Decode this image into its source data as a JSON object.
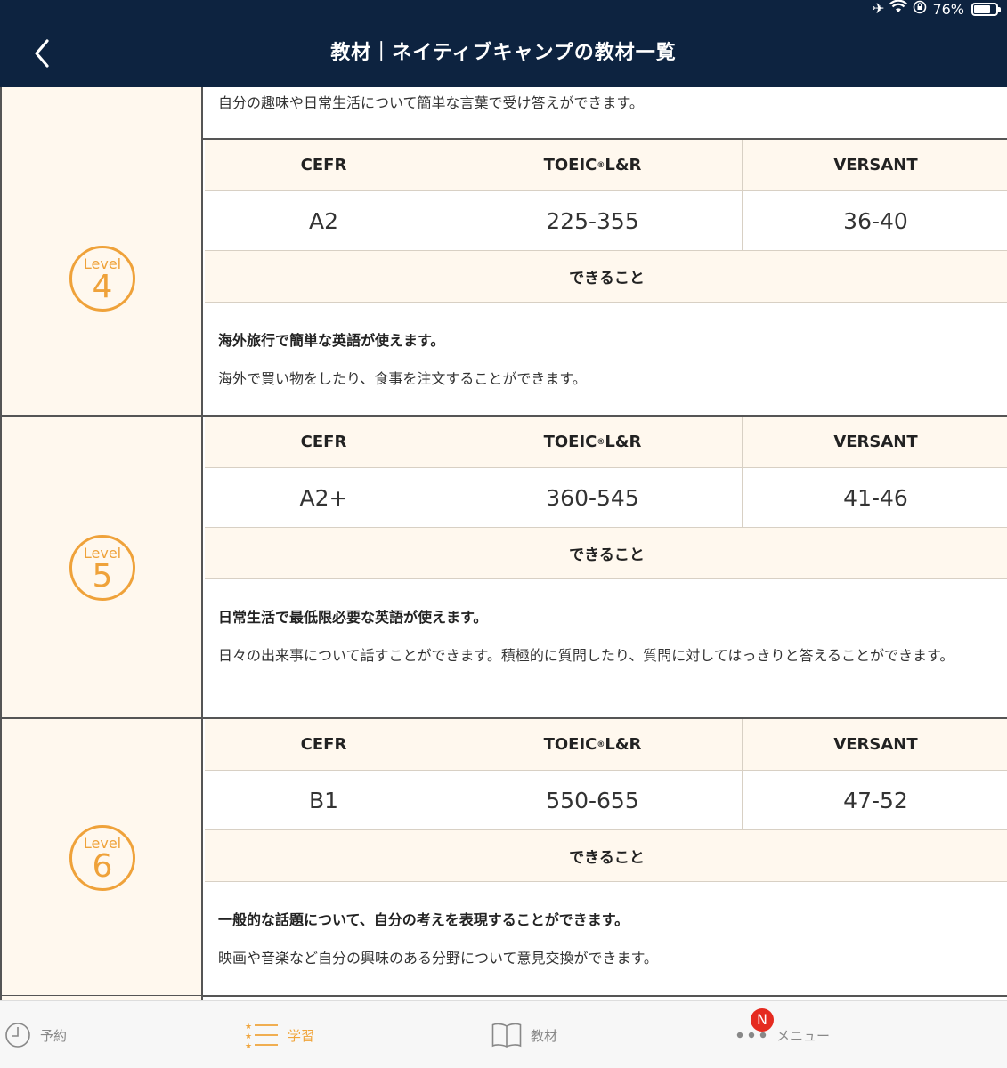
{
  "status_bar": {
    "battery_text": "76%",
    "battery_level": 0.76,
    "icons": [
      "airplane-icon",
      "wifi-icon",
      "orientation-lock-icon",
      "battery-icon"
    ]
  },
  "header": {
    "back_icon": "chevron-left-icon",
    "title": "教材｜ネイティブキャンプの教材一覧"
  },
  "top_partial_text": "自分の趣味や日常生活について簡単な言葉で受け答えができます。",
  "table": {
    "col_cefr": "CEFR",
    "col_toeic_prefix": "TOEIC",
    "col_toeic_mark": "®",
    "col_toeic_suffix": "L&R",
    "col_versant": "VERSANT",
    "can_do_label": "できること"
  },
  "levels": [
    {
      "badge_word": "Level",
      "number": "4",
      "cefr": "A2",
      "toeic": "225-355",
      "versant": "36-40",
      "headline": "海外旅行で簡単な英語が使えます。",
      "body": "海外で買い物をしたり、食事を注文することができます。"
    },
    {
      "badge_word": "Level",
      "number": "5",
      "cefr": "A2+",
      "toeic": "360-545",
      "versant": "41-46",
      "headline": "日常生活で最低限必要な英語が使えます。",
      "body": "日々の出来事について話すことができます。積極的に質問したり、質問に対してはっきりと答えることができます。"
    },
    {
      "badge_word": "Level",
      "number": "6",
      "cefr": "B1",
      "toeic": "550-655",
      "versant": "47-52",
      "headline": "一般的な話題について、自分の考えを表現することができます。",
      "body": "映画や音楽など自分の興味のある分野について意見交換ができます。"
    }
  ],
  "tabbar": {
    "tabs": [
      {
        "label": "予約",
        "icon": "clock-icon",
        "active": false
      },
      {
        "label": "学習",
        "icon": "star-list-icon",
        "active": true
      },
      {
        "label": "教材",
        "icon": "book-icon",
        "active": false
      },
      {
        "label": "メニュー",
        "icon": "more-dots-icon",
        "active": false
      }
    ],
    "notification_badge": "N"
  },
  "colors": {
    "header_bg": "#0d2340",
    "accent": "#f0a43a",
    "cell_bg": "#fff8ee",
    "badge_red": "#e52b20"
  }
}
